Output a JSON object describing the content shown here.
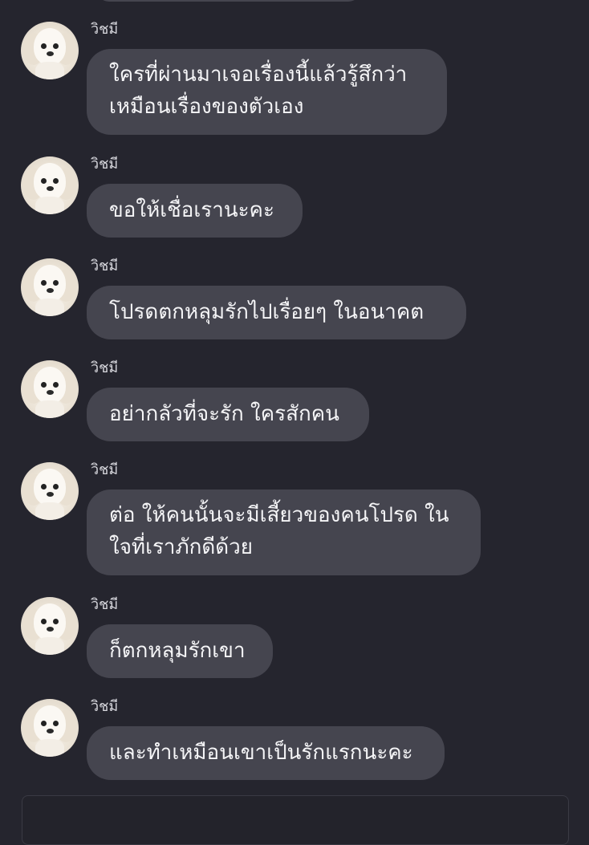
{
  "chat": {
    "messages": [
      {
        "sender": "วิชมี",
        "lines": [
          "ใครที่ผ่านมาเจอเรื่องนี้แล้วรู้สึกว่า",
          "เหมือนเรื่องของตัวเอง"
        ]
      },
      {
        "sender": "วิชมี",
        "lines": [
          "ขอให้เชื่อเรานะคะ"
        ]
      },
      {
        "sender": "วิชมี",
        "lines": [
          "โปรดตกหลุมรักไปเรื่อยๆ ในอนาคต"
        ]
      },
      {
        "sender": "วิชมี",
        "lines": [
          "อย่ากลัวที่จะรัก ใครสักคน"
        ]
      },
      {
        "sender": "วิชมี",
        "lines": [
          "ต่อ ให้คนนั้นจะมีเสี้ยวของคนโปรด ใน",
          "ใจที่เราภักดีด้วย"
        ]
      },
      {
        "sender": "วิชมี",
        "lines": [
          "ก็ตกหลุมรักเขา"
        ]
      },
      {
        "sender": "วิชมี",
        "lines": [
          "และทำเหมือนเขาเป็นรักแรกนะคะ"
        ]
      }
    ]
  },
  "colors": {
    "background": "#25252e",
    "bubble": "#45454f",
    "text": "#f5f5f7"
  }
}
